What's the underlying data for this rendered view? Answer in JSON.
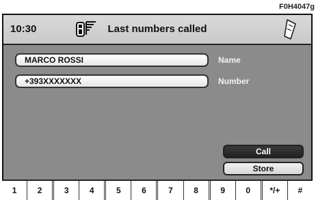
{
  "figure_code": "F0H4047g",
  "header": {
    "time": "10:30",
    "title": "Last numbers called",
    "icons": [
      "phone-signal-icon",
      "handset-icon"
    ]
  },
  "contact": {
    "name_value": "MARCO ROSSI",
    "name_label": "Name",
    "number_value": "+393XXXXXXX",
    "number_label": "Number"
  },
  "actions": {
    "call_label": "Call",
    "store_label": "Store"
  },
  "keypad": [
    "1",
    "2",
    "3",
    "4",
    "5",
    "6",
    "7",
    "8",
    "9",
    "0",
    "*/+",
    "#"
  ]
}
